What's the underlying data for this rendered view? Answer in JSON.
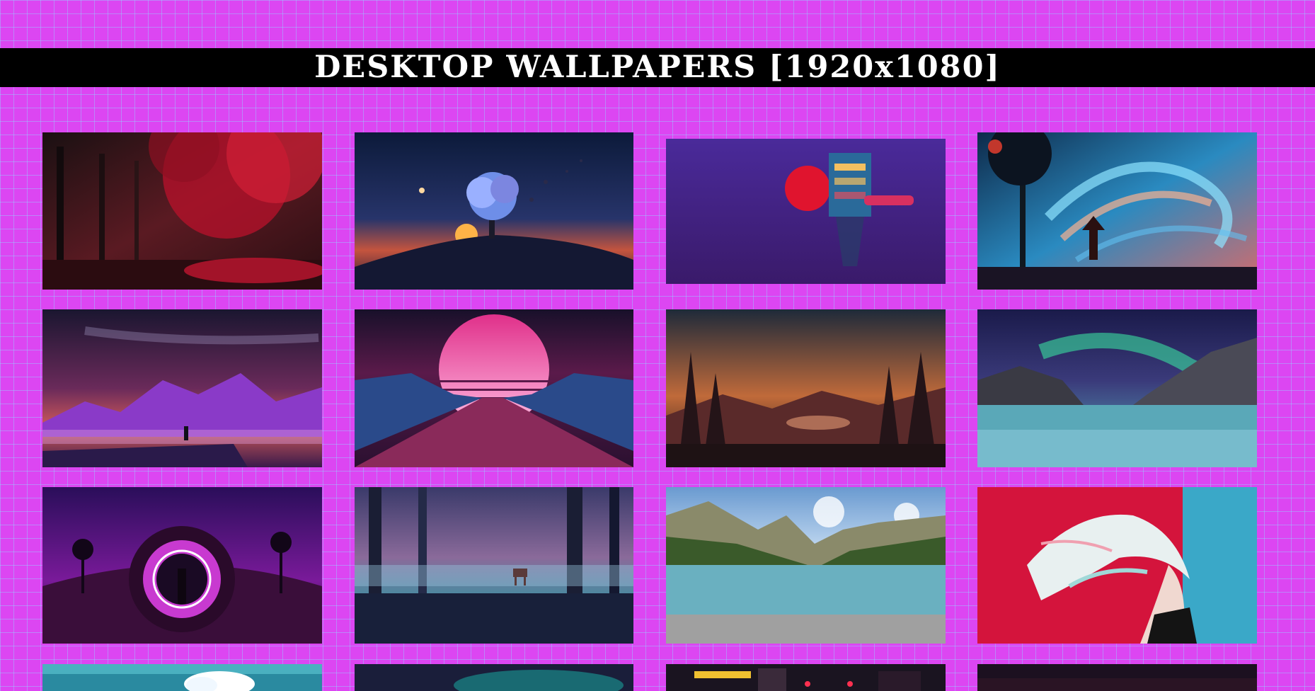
{
  "page": {
    "title": "DESKTOP WALLPAPERS [1920x1080]"
  },
  "colors": {
    "background": "#dc46f2",
    "grid_lines": "#96d2ff",
    "banner_background": "#000000",
    "banner_text": "#ffffff"
  },
  "wallpapers": [
    {
      "name": "red-autumn-forest"
    },
    {
      "name": "blue-tree-on-hill-sunset"
    },
    {
      "name": "floating-tower-red-sun-deer"
    },
    {
      "name": "swirling-sky-tree-figure"
    },
    {
      "name": "purple-mountains-moon-milky-way"
    },
    {
      "name": "synthwave-sun-low-poly-valley"
    },
    {
      "name": "deer-lake-pine-sunset"
    },
    {
      "name": "aurora-over-mountain-lake"
    },
    {
      "name": "neon-portal-astronaut-palms"
    },
    {
      "name": "misty-forest-deer"
    },
    {
      "name": "mountain-lake-clouds"
    },
    {
      "name": "white-hair-anime-girl-red-blue"
    },
    {
      "name": "teal-sky-clouds"
    },
    {
      "name": "dark-teal-aurora"
    },
    {
      "name": "neon-city-night"
    },
    {
      "name": "dark-red-night"
    }
  ]
}
